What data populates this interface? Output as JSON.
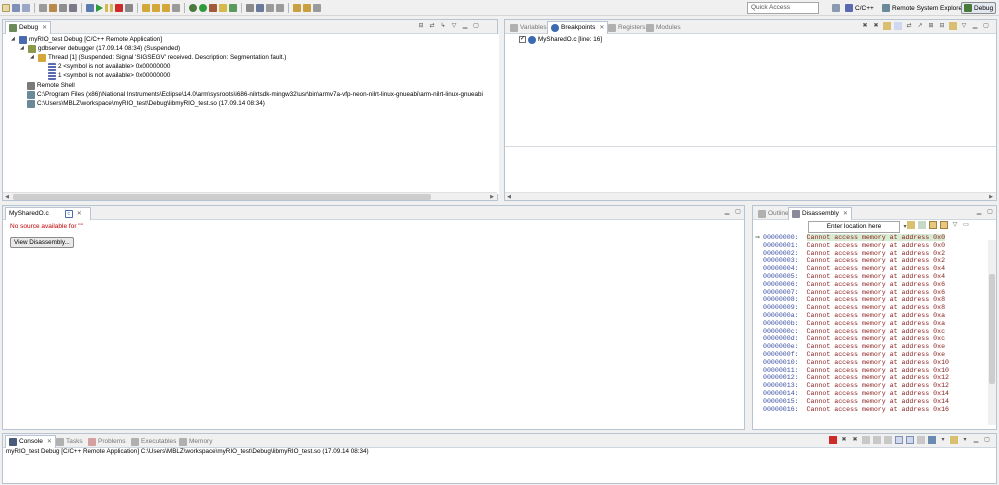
{
  "toolbar": {
    "quick_access_placeholder": "Quick Access",
    "perspectives": [
      {
        "label": "C/C++",
        "active": false
      },
      {
        "label": "Remote System Explorer",
        "active": false
      },
      {
        "label": "Debug",
        "active": true
      }
    ]
  },
  "debug_view": {
    "tab_label": "Debug",
    "tree": [
      {
        "level": 0,
        "twisty": "open",
        "icon": "c-launch-icon",
        "text": "myRIO_test Debug [C/C++ Remote Application]"
      },
      {
        "level": 1,
        "twisty": "open",
        "icon": "debugger-icon",
        "text": "gdbserver debugger (17.09.14 08:34) (Suspended)"
      },
      {
        "level": 2,
        "twisty": "open",
        "icon": "thread-icon",
        "text": "Thread [1] (Suspended: Signal 'SIGSEGV' received. Description: Segmentation fault.)"
      },
      {
        "level": 3,
        "twisty": "none",
        "icon": "stack-frame-icon",
        "text": "2 <symbol is not available> 0x00000000"
      },
      {
        "level": 3,
        "twisty": "none",
        "icon": "stack-frame-icon",
        "text": "1 <symbol is not available> 0x00000000"
      },
      {
        "level": 1,
        "twisty": "none",
        "icon": "remote-shell-icon",
        "text": "Remote Shell"
      },
      {
        "level": 1,
        "twisty": "none",
        "icon": "process-icon",
        "text": "C:\\Program Files (x86)\\National Instruments\\Eclipse\\14.0\\arm\\sysroots\\i686-nilrtsdk-mingw32\\usr\\bin\\armv7a-vfp-neon-nilrt-linux-gnueabi\\arm-nilrt-linux-gnueabi"
      },
      {
        "level": 1,
        "twisty": "none",
        "icon": "process-icon",
        "text": "C:\\Users\\MBLZ\\workspace\\myRIO_test\\Debug\\libmyRIO_test.so (17.09.14 08:34)"
      }
    ]
  },
  "variables_view": {
    "tabs": [
      {
        "label": "Variables",
        "active": false
      },
      {
        "label": "Breakpoints",
        "active": true
      },
      {
        "label": "Registers",
        "active": false
      },
      {
        "label": "Modules",
        "active": false
      }
    ],
    "breakpoints": [
      {
        "checked": true,
        "label": "MySharedO.c [line: 16]"
      }
    ]
  },
  "editor": {
    "tab_label": "MySharedO.c",
    "no_source_text": "No source available for \"\"",
    "button_label": "View Disassembly..."
  },
  "outline_view": {
    "tabs": [
      {
        "label": "Outline",
        "active": false
      },
      {
        "label": "Disassembly",
        "active": true
      }
    ],
    "location_placeholder": "Enter location here",
    "rows": [
      {
        "addr": "00000000:",
        "text": "Cannot access memory at address 0x0",
        "current": true
      },
      {
        "addr": "00000001:",
        "text": "Cannot access memory at address 0x0",
        "current": false
      },
      {
        "addr": "00000002:",
        "text": "Cannot access memory at address 0x2",
        "current": false
      },
      {
        "addr": "00000003:",
        "text": "Cannot access memory at address 0x2",
        "current": false
      },
      {
        "addr": "00000004:",
        "text": "Cannot access memory at address 0x4",
        "current": false
      },
      {
        "addr": "00000005:",
        "text": "Cannot access memory at address 0x4",
        "current": false
      },
      {
        "addr": "00000006:",
        "text": "Cannot access memory at address 0x6",
        "current": false
      },
      {
        "addr": "00000007:",
        "text": "Cannot access memory at address 0x6",
        "current": false
      },
      {
        "addr": "00000008:",
        "text": "Cannot access memory at address 0x8",
        "current": false
      },
      {
        "addr": "00000009:",
        "text": "Cannot access memory at address 0x8",
        "current": false
      },
      {
        "addr": "0000000a:",
        "text": "Cannot access memory at address 0xa",
        "current": false
      },
      {
        "addr": "0000000b:",
        "text": "Cannot access memory at address 0xa",
        "current": false
      },
      {
        "addr": "0000000c:",
        "text": "Cannot access memory at address 0xc",
        "current": false
      },
      {
        "addr": "0000000d:",
        "text": "Cannot access memory at address 0xc",
        "current": false
      },
      {
        "addr": "0000000e:",
        "text": "Cannot access memory at address 0xe",
        "current": false
      },
      {
        "addr": "0000000f:",
        "text": "Cannot access memory at address 0xe",
        "current": false
      },
      {
        "addr": "00000010:",
        "text": "Cannot access memory at address 0x10",
        "current": false
      },
      {
        "addr": "00000011:",
        "text": "Cannot access memory at address 0x10",
        "current": false
      },
      {
        "addr": "00000012:",
        "text": "Cannot access memory at address 0x12",
        "current": false
      },
      {
        "addr": "00000013:",
        "text": "Cannot access memory at address 0x12",
        "current": false
      },
      {
        "addr": "00000014:",
        "text": "Cannot access memory at address 0x14",
        "current": false
      },
      {
        "addr": "00000015:",
        "text": "Cannot access memory at address 0x14",
        "current": false
      },
      {
        "addr": "00000016:",
        "text": "Cannot access memory at address 0x16",
        "current": false
      }
    ]
  },
  "console_view": {
    "tabs": [
      {
        "label": "Console",
        "active": true
      },
      {
        "label": "Tasks",
        "active": false
      },
      {
        "label": "Problems",
        "active": false
      },
      {
        "label": "Executables",
        "active": false
      },
      {
        "label": "Memory",
        "active": false
      }
    ],
    "line": "myRIO_test Debug [C/C++ Remote Application] C:\\Users\\MBLZ\\workspace\\myRIO_test\\Debug\\libmyRIO_test.so (17.09.14 08:34)"
  },
  "colors": {
    "panel_border": "#b9c4d2",
    "error_text": "#c00000",
    "disasm_address": "#3a4fa0",
    "disasm_text": "#8a1a1a",
    "disasm_current_bg": "#d7ecd2"
  }
}
